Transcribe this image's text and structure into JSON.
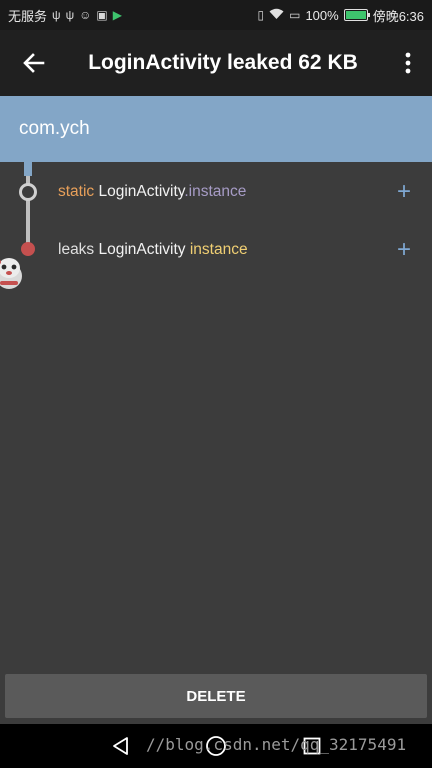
{
  "status_bar": {
    "carrier": "无服务",
    "battery_percent": "100%",
    "battery_level": 1.0,
    "time": "傍晚6:36",
    "left_icons": [
      "usb-icon",
      "usb-icon",
      "face-icon",
      "briefcase-icon",
      "play-store-icon"
    ],
    "right_icons": [
      "vibrate-icon",
      "wifi-icon",
      "sim-icon",
      "battery-icon"
    ]
  },
  "app_bar": {
    "back_icon": "arrow-left-icon",
    "title": "LoginActivity leaked 62 KB",
    "overflow_icon": "more-vert-icon"
  },
  "package_header": {
    "label": "com.ych"
  },
  "leak_trace": [
    {
      "prefix": "static",
      "class_name": "LoginActivity",
      "field": ".instance",
      "expand_icon": "plus-icon"
    },
    {
      "prefix": "leaks",
      "class_name": "LoginActivity",
      "field": "instance",
      "expand_icon": "plus-icon"
    }
  ],
  "delete_button": {
    "label": "DELETE"
  },
  "nav_bar": {
    "back_icon": "triangle-back-icon",
    "home_icon": "circle-home-icon",
    "recents_icon": "square-recents-icon"
  },
  "watermark": "//blog.csdn.net/qq_32175491",
  "colors": {
    "app_bar": "#202020",
    "header": "#83a6c7",
    "background": "#3c3c3c",
    "accent_blue": "#7fa8d2",
    "leak_node": "#c5504f",
    "prefix_orange": "#e8a05a",
    "field_yellow": "#f0cf73",
    "field_purple": "#a79cc6"
  }
}
